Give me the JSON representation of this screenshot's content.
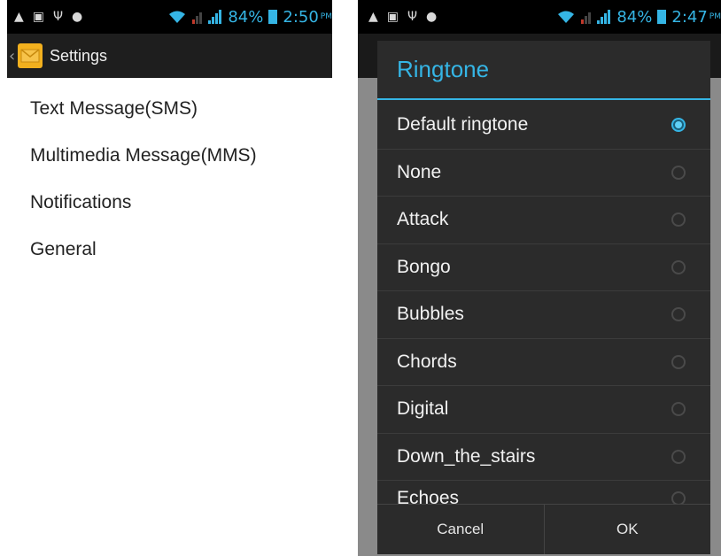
{
  "left": {
    "status": {
      "battery_pct": "84%",
      "time": "2:50",
      "ampm": "PM"
    },
    "actionbar": {
      "title": "Settings"
    },
    "menu": [
      {
        "label": "Text Message(SMS)"
      },
      {
        "label": "Multimedia Message(MMS)"
      },
      {
        "label": "Notifications"
      },
      {
        "label": "General"
      }
    ]
  },
  "right": {
    "status": {
      "battery_pct": "84%",
      "time": "2:47",
      "ampm": "PM"
    },
    "dialog": {
      "title": "Ringtone",
      "selected": "Default ringtone",
      "options": [
        {
          "label": "Default ringtone"
        },
        {
          "label": "None"
        },
        {
          "label": "Attack"
        },
        {
          "label": "Bongo"
        },
        {
          "label": "Bubbles"
        },
        {
          "label": "Chords"
        },
        {
          "label": "Digital"
        },
        {
          "label": "Down_the_stairs"
        },
        {
          "label": "Echoes"
        }
      ],
      "cancel_label": "Cancel",
      "ok_label": "OK"
    }
  },
  "colors": {
    "accent": "#35b5e5",
    "dialog_bg": "#2b2b2b",
    "app_icon": "#f2b01e"
  }
}
